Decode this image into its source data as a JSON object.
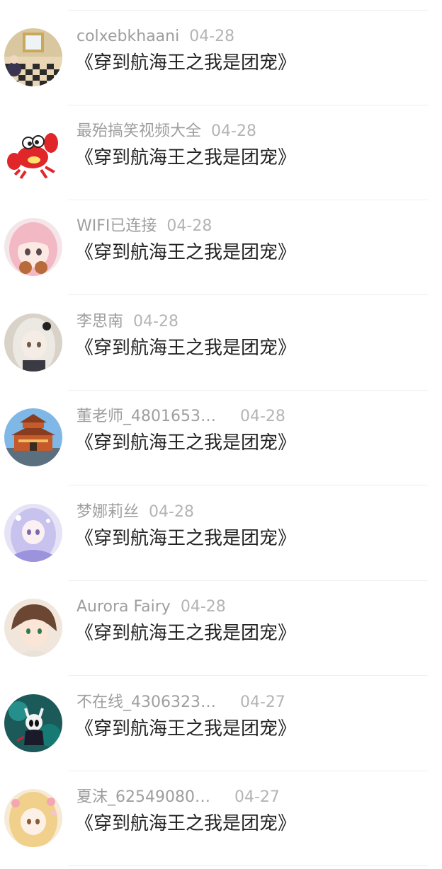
{
  "comments": [
    {
      "username": "colxebkhaani",
      "date": "04-28",
      "text": "《穿到航海王之我是团宠》",
      "avatar_icon": "chessboard-room-avatar-icon"
    },
    {
      "username": "最殆搞笑视频大全",
      "date": "04-28",
      "text": "《穿到航海王之我是团宠》",
      "avatar_icon": "red-crab-avatar-icon"
    },
    {
      "username": "WIFI已连接",
      "date": "04-28",
      "text": "《穿到航海王之我是团宠》",
      "avatar_icon": "pink-anime-girl-avatar-icon"
    },
    {
      "username": "李思南",
      "date": "04-28",
      "text": "《穿到航海王之我是团宠》",
      "avatar_icon": "white-hair-anime-girl-avatar-icon"
    },
    {
      "username": "董老师_4801653…",
      "date": "04-28",
      "text": "《穿到航海王之我是团宠》",
      "avatar_icon": "bell-tower-avatar-icon"
    },
    {
      "username": "梦娜莉丝",
      "date": "04-28",
      "text": "《穿到航海王之我是团宠》",
      "avatar_icon": "lavender-anime-girl-avatar-icon"
    },
    {
      "username": "Aurora Fairy",
      "date": "04-28",
      "text": "《穿到航海王之我是团宠》",
      "avatar_icon": "brown-hair-anime-boy-avatar-icon"
    },
    {
      "username": "不在线_4306323…",
      "date": "04-27",
      "text": "《穿到航海王之我是团宠》",
      "avatar_icon": "hollow-knight-avatar-icon"
    },
    {
      "username": "夏沫_62549080…",
      "date": "04-27",
      "text": "《穿到航海王之我是团宠》",
      "avatar_icon": "blonde-anime-girl-avatar-icon"
    }
  ],
  "colors": {
    "username": "#9e9e9e",
    "date": "#b4b4b4",
    "text": "#222222",
    "divider": "#efefef"
  }
}
